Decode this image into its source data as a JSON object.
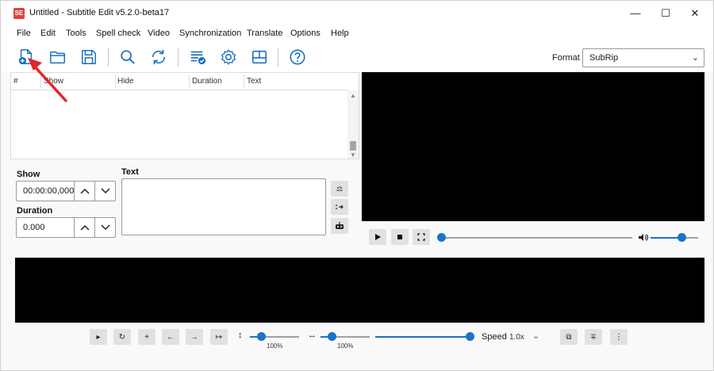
{
  "window": {
    "title": "Untitled - Subtitle Edit v5.2.0-beta17",
    "app_icon_text": "SE",
    "controls": {
      "minimize": "—",
      "maximize": "☐",
      "close": "✕"
    }
  },
  "menu": [
    "File",
    "Edit",
    "Tools",
    "Spell check",
    "Video",
    "Synchronization",
    "Translate",
    "Options",
    "Help"
  ],
  "toolbar": {
    "buttons": [
      "new-file-icon",
      "open-folder-icon",
      "save-icon",
      "find-icon",
      "replace-icon",
      "fix-common-errors-icon",
      "settings-icon",
      "layout-icon",
      "help-icon"
    ],
    "format_label": "Format",
    "format_value": "SubRip"
  },
  "grid": {
    "columns": [
      "#",
      "Show",
      "Hide",
      "Duration",
      "Text"
    ]
  },
  "edit": {
    "show_label": "Show",
    "show_value": "00:00:00,000",
    "duration_label": "Duration",
    "duration_value": "0.000",
    "text_label": "Text"
  },
  "player": {
    "position_fraction": 0.0,
    "volume_fraction": 0.65
  },
  "waveform_controls": {
    "vertical_zoom": "100%",
    "horizontal_zoom": "100%",
    "speed_label": "Speed",
    "speed_value": "1.0x"
  },
  "colors": {
    "accent": "#1a73c8",
    "icon_blue": "#1a6fbf",
    "arrow_red": "#e0262e",
    "app_icon": "#e0423a"
  }
}
